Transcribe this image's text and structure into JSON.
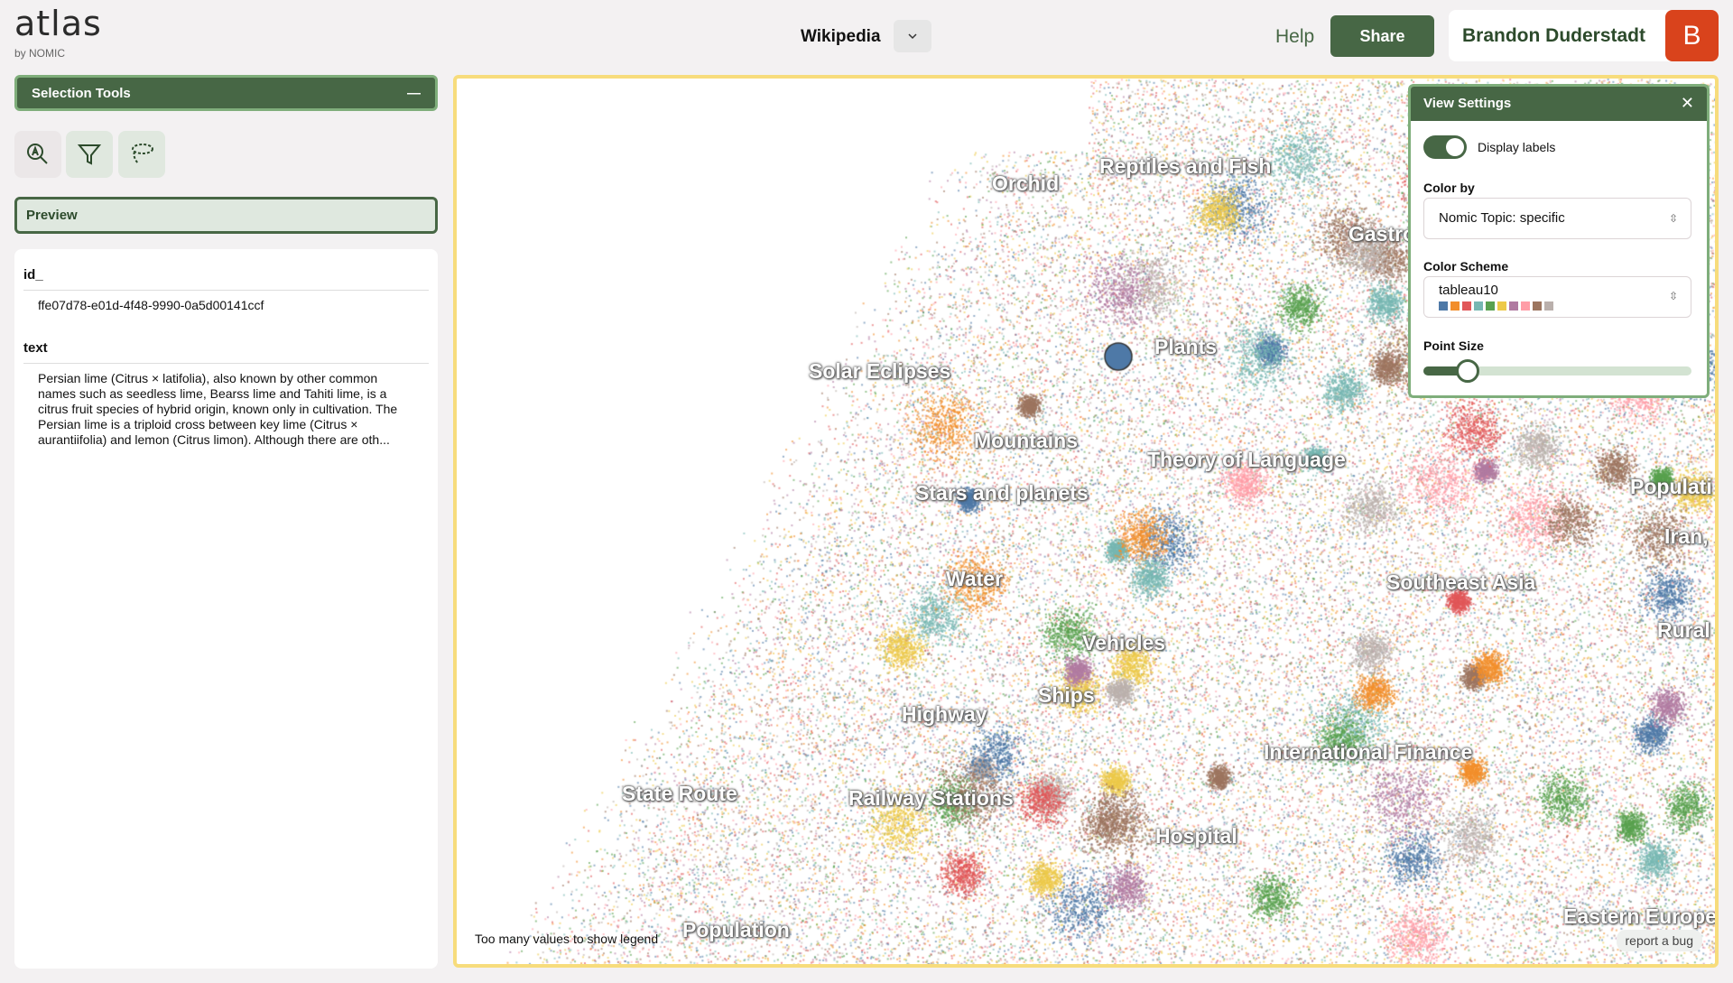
{
  "logo": {
    "name": "atlas",
    "sub": "by NOMIC"
  },
  "sidebar": {
    "selection_tools": "Selection Tools",
    "tools": [
      {
        "icon": "search-icon"
      },
      {
        "icon": "filter-icon"
      },
      {
        "icon": "lasso-icon"
      }
    ],
    "preview": "Preview",
    "fields": [
      {
        "label": "id_",
        "value": "ffe07d78-e01d-4f48-9990-0a5d00141ccf"
      },
      {
        "label": "text",
        "value": "Persian lime (Citrus × latifolia), also known by other common names such as seedless lime, Bearss lime and Tahiti lime, is a citrus fruit species of hybrid origin, known only in cultivation. The Persian lime is a triploid cross between key lime (Citrus × aurantiifolia) and lemon (Citrus limon). Although there are oth..."
      }
    ]
  },
  "header": {
    "dataset": "Wikipedia",
    "help": "Help",
    "share": "Share",
    "user": "Brandon Duderstadt",
    "avatar": "B"
  },
  "map": {
    "labels": [
      "Orchid",
      "Reptiles and Fish",
      "Gastro",
      "Plants",
      "Solar Eclipses",
      "Mountains",
      "Theory of Language",
      "Stars and planets",
      "Populati",
      "Iran,",
      "Water",
      "Southeast Asia",
      "Rural",
      "Vehicles",
      "Ships",
      "Highway",
      "International Finance",
      "State Route",
      "Railway Stations",
      "Hospital",
      "Eastern Europe",
      "Population"
    ],
    "legend_note": "Too many values to show legend",
    "report_bug": "report a bug"
  },
  "view_settings": {
    "title": "View Settings",
    "display_labels": "Display labels",
    "display_labels_on": true,
    "color_by_label": "Color by",
    "color_by": "Nomic Topic: specific",
    "color_scheme_label": "Color Scheme",
    "color_scheme": "tableau10",
    "scheme_colors": [
      "#4e79a7",
      "#f28e2b",
      "#e15759",
      "#76b7b2",
      "#59a14f",
      "#edc948",
      "#b07aa1",
      "#ff9da7",
      "#9c755f",
      "#bab0ac"
    ],
    "point_size_label": "Point Size",
    "point_size": 0.13
  },
  "colors": {
    "accent": "#476745",
    "highlight": "#f7dc7c",
    "avatar": "#d9431c"
  }
}
